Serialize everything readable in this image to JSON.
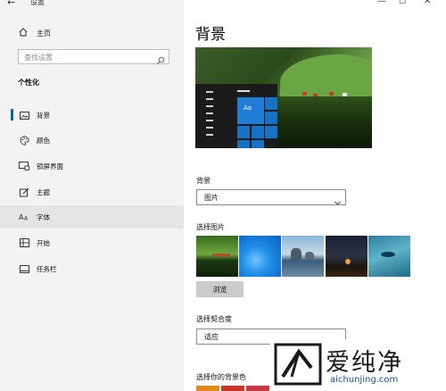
{
  "window": {
    "title": "设置",
    "back_glyph": "←",
    "minimize_glyph": "—",
    "maximize_glyph": "☐",
    "close_glyph": "✕"
  },
  "sidebar": {
    "home_label": "主页",
    "search_placeholder": "查找设置",
    "section_title": "个性化",
    "items": [
      {
        "label": "背景",
        "icon": "image-icon",
        "active": true
      },
      {
        "label": "颜色",
        "icon": "palette-icon"
      },
      {
        "label": "锁屏界面",
        "icon": "lock-screen-icon"
      },
      {
        "label": "主题",
        "icon": "theme-brush-icon"
      },
      {
        "label": "字体",
        "icon": "font-icon",
        "hovered": true
      },
      {
        "label": "开始",
        "icon": "start-grid-icon"
      },
      {
        "label": "任务栏",
        "icon": "taskbar-icon"
      }
    ]
  },
  "main": {
    "title": "背景",
    "preview_tile_label": "Aa",
    "background_label": "背景",
    "background_value": "图片",
    "choose_picture_label": "选择图片",
    "browse_label": "浏览",
    "fit_label": "选择契合度",
    "fit_value": "适应",
    "bg_color_label": "选择你的背景色"
  },
  "watermark": {
    "text": "爱纯净",
    "url": "aichunjing.com"
  },
  "colors": {
    "accent": "#0067c0",
    "sidebar_bg": "#f3f3f3",
    "swatches": [
      "#e08a1e",
      "#c8352e",
      "#c73a44"
    ]
  }
}
